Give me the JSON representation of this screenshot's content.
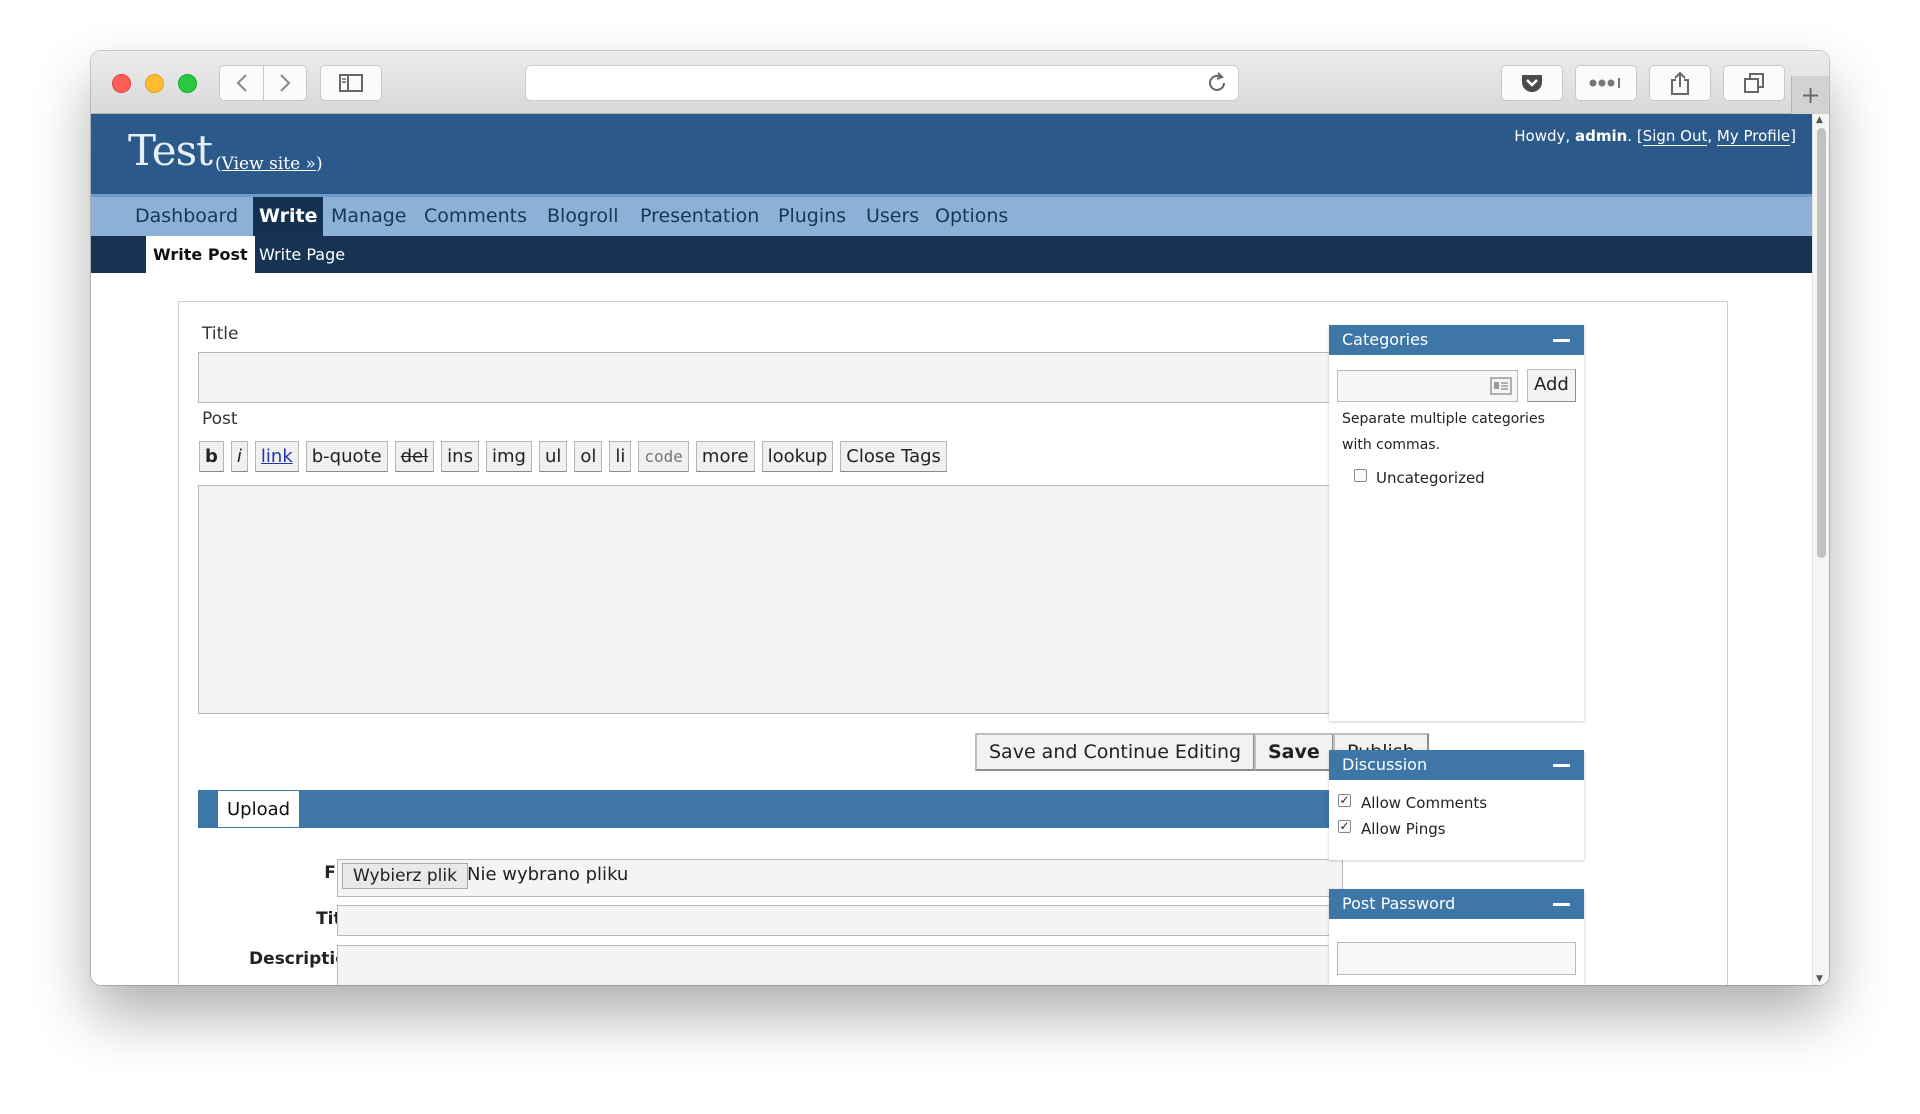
{
  "browser": {
    "icons": {
      "back": "chevron-left-icon",
      "forward": "chevron-right-icon",
      "sidebar": "sidebar-icon",
      "reload": "reload-icon",
      "pocket": "pocket-icon",
      "extensions": "more-dots-icon",
      "share": "share-icon",
      "tabs": "tabs-icon",
      "new_tab": "plus-icon"
    },
    "new_tab_glyph": "+"
  },
  "header": {
    "site_title": "Test",
    "view_site": "View site »",
    "howdy": "Howdy,",
    "user": "admin",
    "sign_out": "Sign Out",
    "my_profile": "My Profile"
  },
  "menu": {
    "items": [
      "Dashboard",
      "Write",
      "Manage",
      "Comments",
      "Blogroll",
      "Presentation",
      "Plugins",
      "Users",
      "Options"
    ],
    "current": "Write"
  },
  "submenu": {
    "items": [
      "Write Post",
      "Write Page"
    ],
    "current": "Write Post"
  },
  "editor": {
    "title_label": "Title",
    "title_value": "",
    "post_label": "Post",
    "post_value": "",
    "quicktags": [
      "b",
      "i",
      "link",
      "b-quote",
      "del",
      "ins",
      "img",
      "ul",
      "ol",
      "li",
      "code",
      "more",
      "lookup",
      "Close Tags"
    ],
    "buttons": {
      "save_continue": "Save and Continue Editing",
      "save": "Save",
      "publish": "Publish"
    }
  },
  "upload": {
    "tab": "Upload",
    "file_label": "File",
    "file_button": "Wybierz plik",
    "file_status": "Nie wybrano pliku",
    "title_label": "Title",
    "description_label": "Description"
  },
  "sidebar": {
    "categories": {
      "title": "Categories",
      "add_button": "Add",
      "hint": "Separate multiple categories with commas.",
      "hint_line1": "Separate multiple categories",
      "hint_line2": "with commas.",
      "items": [
        {
          "label": "Uncategorized",
          "checked": false
        }
      ]
    },
    "discussion": {
      "title": "Discussion",
      "allow_comments": "Allow Comments",
      "allow_comments_checked": true,
      "allow_pings": "Allow Pings",
      "allow_pings_checked": true
    },
    "post_password": {
      "title": "Post Password",
      "value": ""
    }
  },
  "colors": {
    "header": "#2b5a8a",
    "menu": "#8cb1d6",
    "submenu": "#163353",
    "box_header": "#3e76a8"
  }
}
